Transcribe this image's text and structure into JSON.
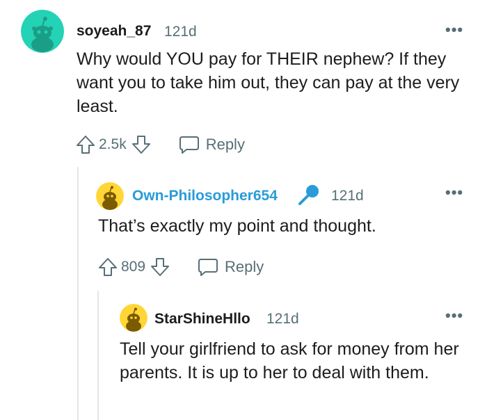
{
  "comments": [
    {
      "username": "soyeah_87",
      "age": "121d",
      "more": "•••",
      "body": "Why would YOU pay for THEIR nephew? If they want you to take him out, they can pay at the very least.",
      "score": "2.5k",
      "reply_label": "Reply",
      "avatar_color": "#24d2b5"
    },
    {
      "username": "Own-Philosopher654",
      "age": "121d",
      "more": "•••",
      "body": "That’s exactly my point and thought.",
      "score": "809",
      "reply_label": "Reply",
      "avatar_color": "#ffd635",
      "username_color": "#2a9bd8",
      "flair_icon": "microphone-icon"
    },
    {
      "username": "StarShineHllo",
      "age": "121d",
      "more": "•••",
      "body": "Tell your girlfriend to ask for money from her parents. It is up to her to deal with them.",
      "avatar_color": "#ffd635"
    }
  ],
  "colors": {
    "meta_text": "#576f76",
    "thread_line": "#e6e6e6",
    "op_badge_blue": "#2a9bd8"
  }
}
